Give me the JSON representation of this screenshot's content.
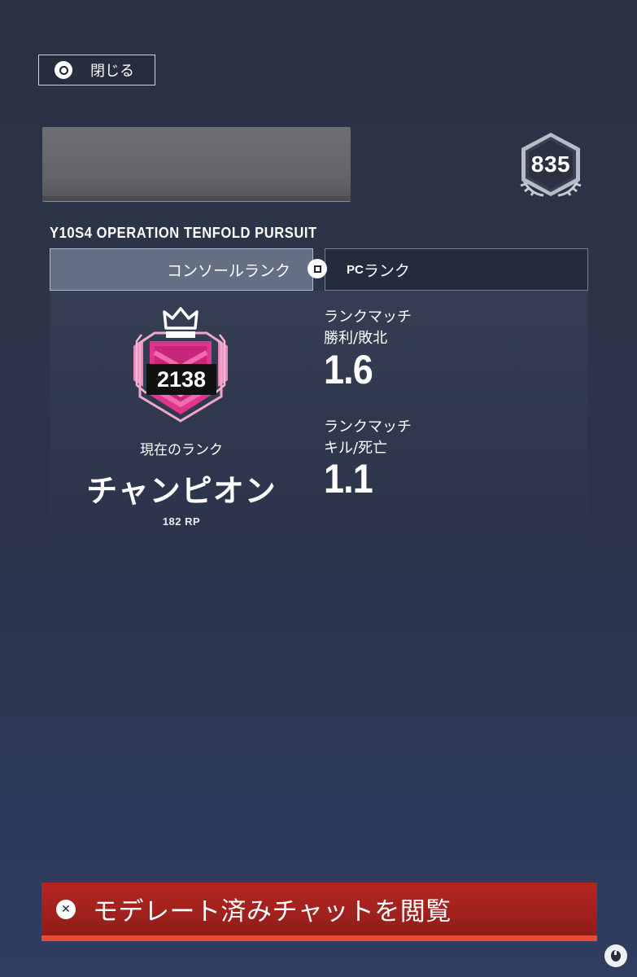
{
  "close_button": {
    "label": "閉じる",
    "glyph": "circle-button-icon"
  },
  "player": {
    "level": "835",
    "level_badge_icon": "hexagon-laurel-icon"
  },
  "season": {
    "title": "Y10S4 OPERATION TENFOLD PURSUIT"
  },
  "tabs": {
    "console_label": "コンソールランク",
    "swap_glyph": "square-button-icon",
    "pc_prefix": "PC",
    "pc_suffix": "ランク",
    "active": "console"
  },
  "rank": {
    "points": "2138",
    "current_label": "現在のランク",
    "name": "チャンピオン",
    "rp": "182 RP",
    "emblem_color": "#e0358f"
  },
  "stats": [
    {
      "label_line1": "ランクマッチ",
      "label_line2": "勝利/敗北",
      "value": "1.6"
    },
    {
      "label_line1": "ランクマッチ",
      "label_line2": "キル/死亡",
      "value": "1.1"
    }
  ],
  "chat_button": {
    "label": "モデレート済みチャットを閲覧",
    "glyph": "cross-button-icon",
    "color": "#a0211d",
    "accent": "#e94a36"
  }
}
